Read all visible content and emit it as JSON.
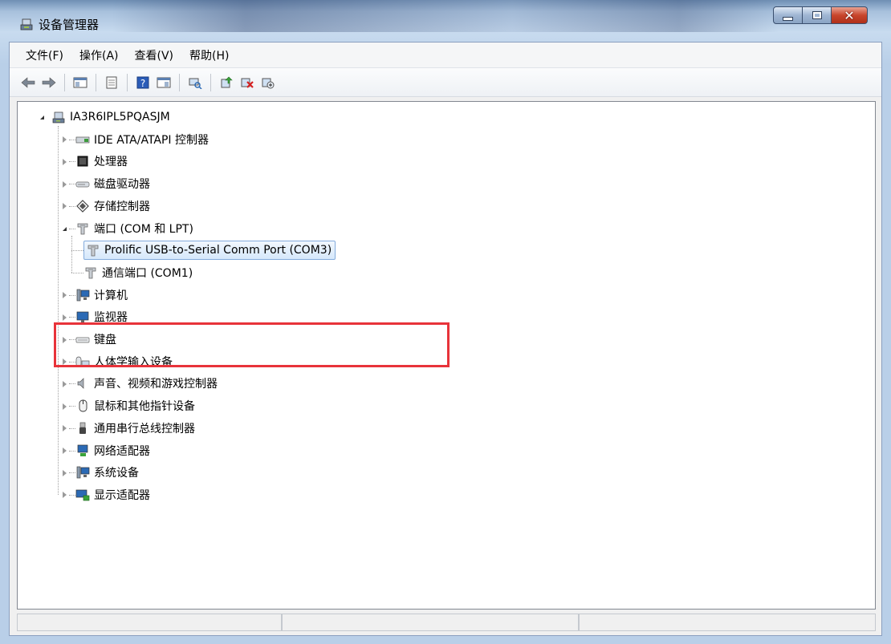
{
  "window": {
    "title": "设备管理器",
    "minimize_label": "minimize",
    "maximize_label": "maximize",
    "close_label": "close"
  },
  "menu": [
    "文件(F)",
    "操作(A)",
    "查看(V)",
    "帮助(H)"
  ],
  "toolbar": {
    "buttons": [
      "back-icon",
      "forward-icon",
      "show-hide-console-tree-icon",
      "properties-icon",
      "help-icon",
      "show-hide-action-pane-icon",
      "scan-hardware-icon",
      "update-driver-icon",
      "uninstall-icon",
      "disable-icon"
    ]
  },
  "tree": {
    "root": "IA3R6IPL5PQASJM",
    "categories": [
      {
        "label": "IDE ATA/ATAPI 控制器",
        "icon": "ide-controller-icon",
        "expanded": false
      },
      {
        "label": "处理器",
        "icon": "processor-icon",
        "expanded": false
      },
      {
        "label": "磁盘驱动器",
        "icon": "disk-drive-icon",
        "expanded": false
      },
      {
        "label": "存储控制器",
        "icon": "storage-controller-icon",
        "expanded": false
      },
      {
        "label": "端口 (COM 和 LPT)",
        "icon": "port-icon",
        "expanded": true,
        "children": [
          "Prolific USB-to-Serial Comm Port (COM3)",
          "通信端口 (COM1)"
        ]
      },
      {
        "label": "计算机",
        "icon": "computer-icon",
        "expanded": false
      },
      {
        "label": "监视器",
        "icon": "monitor-icon",
        "expanded": false
      },
      {
        "label": "键盘",
        "icon": "keyboard-icon",
        "expanded": false
      },
      {
        "label": "人体学输入设备",
        "icon": "hid-icon",
        "expanded": false
      },
      {
        "label": "声音、视频和游戏控制器",
        "icon": "sound-icon",
        "expanded": false
      },
      {
        "label": "鼠标和其他指针设备",
        "icon": "mouse-icon",
        "expanded": false
      },
      {
        "label": "通用串行总线控制器",
        "icon": "usb-icon",
        "expanded": false
      },
      {
        "label": "网络适配器",
        "icon": "network-adapter-icon",
        "expanded": false
      },
      {
        "label": "系统设备",
        "icon": "system-device-icon",
        "expanded": false
      },
      {
        "label": "显示适配器",
        "icon": "display-adapter-icon",
        "expanded": false
      }
    ],
    "selected": "Prolific USB-to-Serial Comm Port (COM3)"
  },
  "colors": {
    "highlight_box": "#e8333a",
    "selection_border": "#84acdd"
  }
}
